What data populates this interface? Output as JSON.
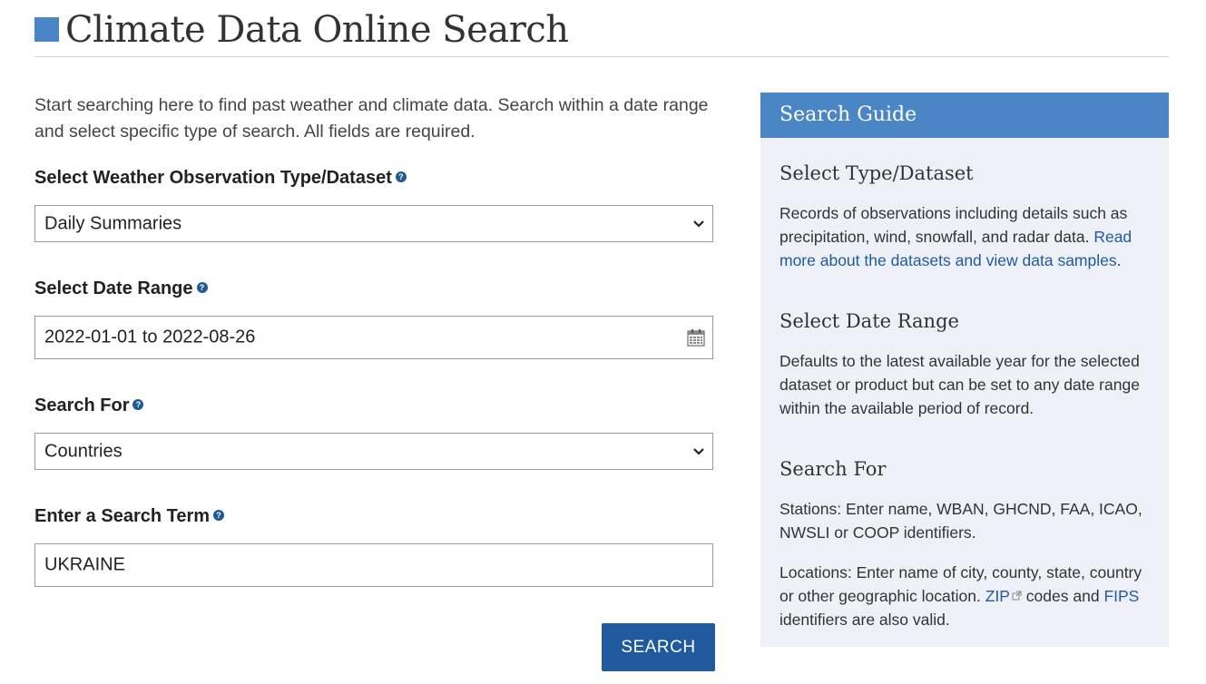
{
  "page": {
    "title": "Climate Data Online Search",
    "intro": "Start searching here to find past weather and climate data. Search within a date range and select specific type of search. All fields are required."
  },
  "form": {
    "dataset": {
      "label": "Select Weather Observation Type/Dataset",
      "value": "Daily Summaries"
    },
    "date_range": {
      "label": "Select Date Range",
      "start": "2022-01-01",
      "separator": "to",
      "end": "2022-08-26"
    },
    "search_for": {
      "label": "Search For",
      "value": "Countries"
    },
    "search_term": {
      "label": "Enter a Search Term",
      "value": "UKRAINE"
    },
    "help_glyph": "?",
    "submit_label": "SEARCH"
  },
  "guide": {
    "title": "Search Guide",
    "type_heading": "Select Type/Dataset",
    "type_text": "Records of observations including details such as precipitation, wind, snowfall, and radar data.",
    "type_link": "Read more about the datasets and view data samples",
    "type_after": ".",
    "date_heading": "Select Date Range",
    "date_text": "Defaults to the latest available year for the selected dataset or product but can be set to any date range within the available period of record.",
    "searchfor_heading": "Search For",
    "stations_text": "Stations: Enter name, WBAN, GHCND, FAA, ICAO, NWSLI or COOP identifiers.",
    "locations_before": "Locations: Enter name of city, county, state, country or other geographic location.",
    "zip_link": "ZIP",
    "codes_and": "codes and",
    "fips_link": "FIPS",
    "locations_after": "identifiers are also valid."
  },
  "colors": {
    "accent": "#4a86c5",
    "button": "#1f5a9f",
    "guide_bg": "#eef0f8",
    "link": "#1f5a9f"
  },
  "icons": [
    "help-icon",
    "chevron-down-icon",
    "calendar-icon",
    "external-link-icon"
  ]
}
